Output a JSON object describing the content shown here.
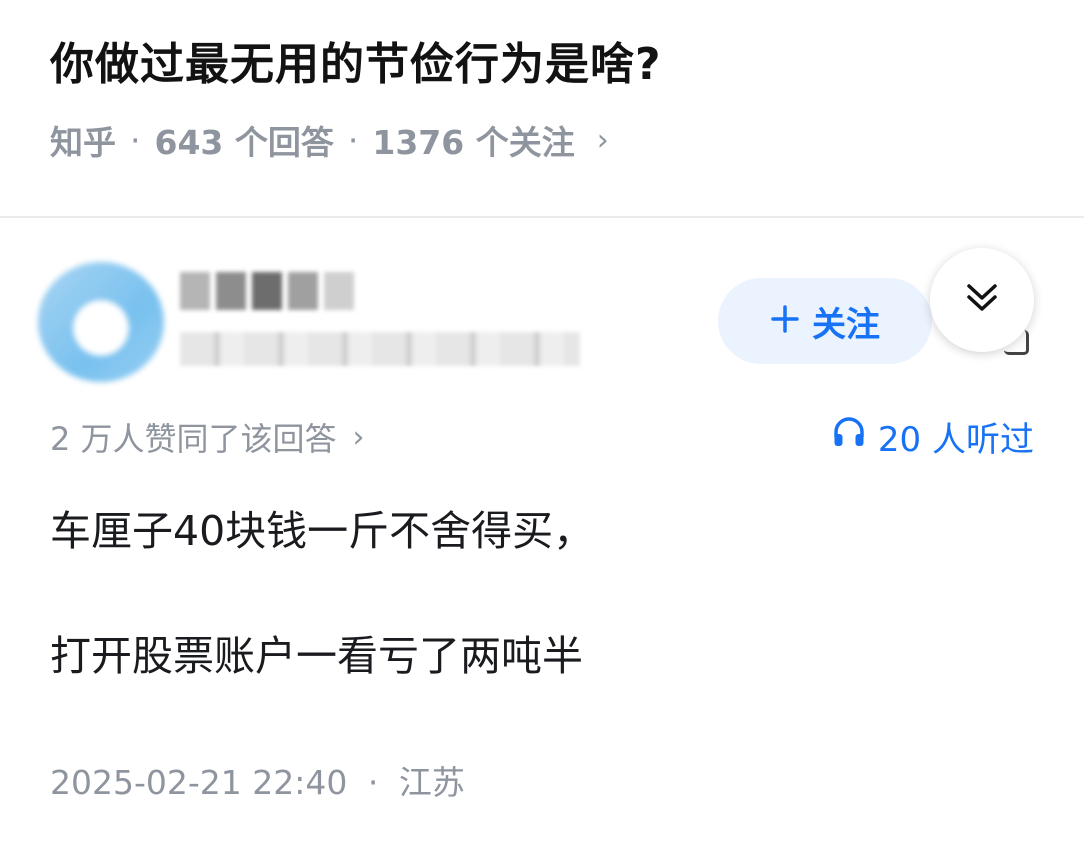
{
  "question": {
    "title": "你做过最无用的节俭行为是啥?",
    "source": "知乎",
    "answers_count": "643 个回答",
    "followers_count": "1376 个关注",
    "separator": "·",
    "chevron": "›"
  },
  "author": {
    "follow_label": "关注",
    "follow_icon": "plus-icon",
    "collapse_icon": "double-chevron-down-icon"
  },
  "answer": {
    "votes_text": "2 万人赞同了该回答",
    "votes_chevron": "›",
    "listen_icon": "headphones-icon",
    "listen_text": "20 人听过",
    "paragraphs": [
      "车厘子40块钱一斤不舍得买，",
      "打开股票账户一看亏了两吨半"
    ],
    "datetime": "2025-02-21 22:40",
    "separator": "·",
    "location": "江苏"
  },
  "colors": {
    "accent": "#1772f6",
    "accent_bg": "#ebf3fe",
    "muted": "#8f959e",
    "text": "#121212"
  }
}
